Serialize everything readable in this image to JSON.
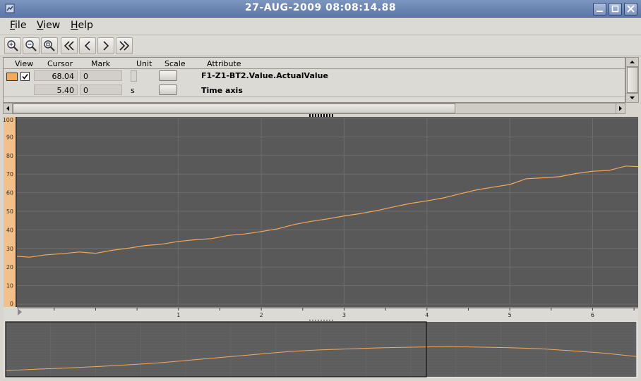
{
  "window": {
    "title": "27-AUG-2009 08:08:14.88"
  },
  "menu": {
    "file": {
      "accel": "F",
      "rest": "ile"
    },
    "view": {
      "accel": "V",
      "rest": "iew"
    },
    "help": {
      "accel": "H",
      "rest": "elp"
    }
  },
  "toolbar": {
    "buttons": [
      "zoom-in-icon",
      "zoom-out-icon",
      "zoom-reset-icon",
      "first-icon",
      "previous-icon",
      "next-icon",
      "last-icon"
    ]
  },
  "attributes": {
    "headers": {
      "view": "View",
      "cursor": "Cursor",
      "mark": "Mark",
      "unit": "Unit",
      "scale": "Scale",
      "attribute": "Attribute"
    },
    "rows": [
      {
        "cursor": "68.04",
        "mark": "0",
        "unit": "",
        "attribute": "F1-Z1-BT2.Value.ActualValue",
        "color": "#f3a95e",
        "checked": true
      },
      {
        "cursor": "5.40",
        "mark": "0",
        "unit": "s",
        "attribute": "Time axis"
      }
    ]
  },
  "chart_data": {
    "type": "line",
    "ylim": [
      0,
      100
    ],
    "yticks": [
      "0",
      "10",
      "20",
      "30",
      "40",
      "50",
      "60",
      "70",
      "80",
      "90",
      "100"
    ],
    "xlim": [
      -0.95,
      6.55
    ],
    "xticks": [
      "1",
      "2",
      "3",
      "4",
      "5",
      "6"
    ],
    "series": [
      {
        "color": "#f3a95e",
        "x": [
          -0.95,
          -0.8,
          -0.6,
          -0.4,
          -0.2,
          0.0,
          0.2,
          0.4,
          0.6,
          0.8,
          1.0,
          1.2,
          1.4,
          1.6,
          1.8,
          2.0,
          2.2,
          2.4,
          2.6,
          2.8,
          3.0,
          3.2,
          3.4,
          3.6,
          3.8,
          4.0,
          4.2,
          4.4,
          4.6,
          4.8,
          5.0,
          5.2,
          5.4,
          5.6,
          5.8,
          6.0,
          6.2,
          6.4,
          6.55
        ],
        "y": [
          25.8,
          25.3,
          26.6,
          27.2,
          28.1,
          27.4,
          29.0,
          30.2,
          31.6,
          32.3,
          33.8,
          34.7,
          35.3,
          37.0,
          37.8,
          39.1,
          40.6,
          42.9,
          44.6,
          45.9,
          47.5,
          48.8,
          50.4,
          52.4,
          54.2,
          55.6,
          57.2,
          59.4,
          61.5,
          63.0,
          64.4,
          67.5,
          68.0,
          68.6,
          70.3,
          71.5,
          72.0,
          74.3,
          74.0
        ]
      }
    ],
    "overview": {
      "x": [
        0,
        5,
        10,
        15,
        20,
        25,
        30,
        35,
        40,
        45,
        50,
        55,
        60,
        65,
        70,
        75,
        80,
        85,
        90,
        95,
        100
      ],
      "y": [
        11,
        14,
        16,
        19,
        22,
        26,
        31,
        36,
        41,
        46,
        49,
        51,
        53,
        54,
        55,
        54,
        53,
        51,
        47,
        43,
        37
      ]
    }
  }
}
